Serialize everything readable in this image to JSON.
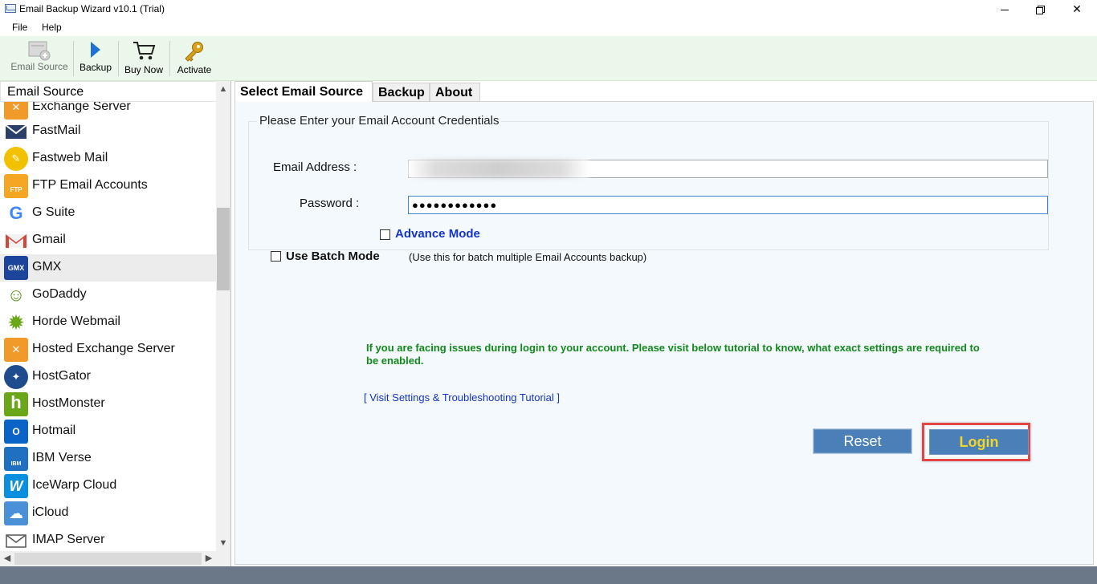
{
  "window": {
    "title": "Email Backup Wizard v10.1 (Trial)"
  },
  "menu": {
    "file": "File",
    "help": "Help"
  },
  "toolbar": {
    "email_source": "Email Source",
    "backup": "Backup",
    "buy_now": "Buy Now",
    "activate": "Activate"
  },
  "sidebar": {
    "header": "Email Source",
    "items": [
      {
        "label": "Exchange Server",
        "icon": "exchange-server-icon",
        "color": "#f19a2a"
      },
      {
        "label": "FastMail",
        "icon": "fastmail-icon",
        "color": "#2b3f6b"
      },
      {
        "label": "Fastweb Mail",
        "icon": "fastweb-icon",
        "color": "#f2c200"
      },
      {
        "label": "FTP Email Accounts",
        "icon": "ftp-icon",
        "color": "#f5a623"
      },
      {
        "label": "G Suite",
        "icon": "google-icon",
        "color": "#4285f4"
      },
      {
        "label": "Gmail",
        "icon": "gmail-icon",
        "color": "#d44638"
      },
      {
        "label": "GMX",
        "icon": "gmx-icon",
        "color": "#1c449b",
        "selected": true
      },
      {
        "label": "GoDaddy",
        "icon": "godaddy-icon",
        "color": "#5b8d1f"
      },
      {
        "label": "Horde Webmail",
        "icon": "horde-icon",
        "color": "#6aa617"
      },
      {
        "label": "Hosted Exchange Server",
        "icon": "hosted-exchange-icon",
        "color": "#f19a2a"
      },
      {
        "label": "HostGator",
        "icon": "hostgator-icon",
        "color": "#1f4c8f"
      },
      {
        "label": "HostMonster",
        "icon": "hostmonster-icon",
        "color": "#6aa617"
      },
      {
        "label": "Hotmail",
        "icon": "hotmail-icon",
        "color": "#0a64c8"
      },
      {
        "label": "IBM Verse",
        "icon": "ibm-verse-icon",
        "color": "#1f70c1"
      },
      {
        "label": "IceWarp Cloud",
        "icon": "icewarp-icon",
        "color": "#0a8fe0"
      },
      {
        "label": "iCloud",
        "icon": "icloud-icon",
        "color": "#4a90d9"
      },
      {
        "label": "IMAP Server",
        "icon": "imap-server-icon",
        "color": "#555555"
      }
    ]
  },
  "tabs": {
    "select_source": "Select Email Source",
    "backup": "Backup",
    "about": "About"
  },
  "credentials": {
    "legend": "Please Enter your Email Account Credentials",
    "email_label": "Email Address :",
    "email_value": "",
    "password_label": "Password :",
    "password_value": "●●●●●●●●●●●●",
    "advance_mode": "Advance Mode",
    "batch_mode": "Use Batch Mode",
    "batch_hint": "(Use this for batch multiple Email Accounts backup)"
  },
  "help": {
    "message": "If you are facing issues during login to your account. Please visit below tutorial to know, what exact settings are required to be enabled.",
    "link": "[ Visit Settings & Troubleshooting Tutorial ]"
  },
  "actions": {
    "reset": "Reset",
    "login": "Login"
  },
  "colors": {
    "accent_button": "#4a7fb8",
    "login_text": "#f3d62a",
    "help_text": "#12891a",
    "link": "#1433c8",
    "highlight_frame": "#e34545",
    "toolbar_bg": "#eaf7ea"
  }
}
